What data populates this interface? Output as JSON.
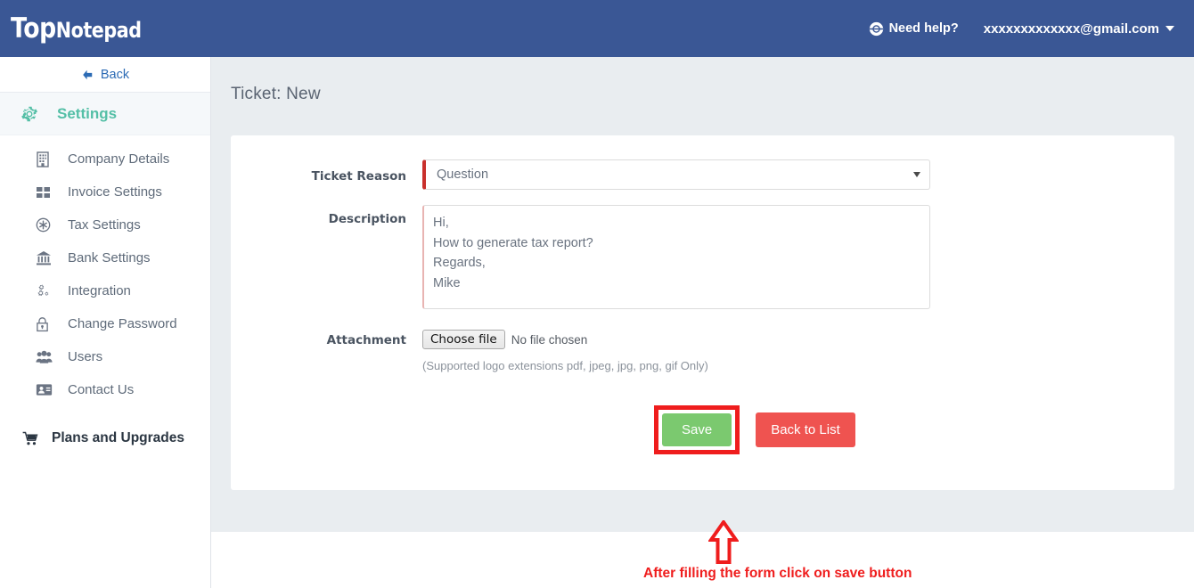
{
  "header": {
    "logo_top": "Top",
    "logo_note": "Notepad",
    "need_help": "Need help?",
    "help_icon": "help-circle-icon",
    "user_email": "xxxxxxxxxxxxx@gmail.com",
    "caret_icon": "chevron-down-icon",
    "background_color": "#3a5795"
  },
  "sidebar": {
    "back_label": "Back",
    "back_icon": "arrow-left-icon",
    "settings_label": "Settings",
    "settings_icon": "gear-icon",
    "settings_color": "#54bfa6",
    "items": [
      {
        "label": "Company Details",
        "icon": "building-icon"
      },
      {
        "label": "Invoice Settings",
        "icon": "grid-squares-icon"
      },
      {
        "label": "Tax Settings",
        "icon": "asterisk-badge-icon"
      },
      {
        "label": "Bank Settings",
        "icon": "bank-icon"
      },
      {
        "label": "Integration",
        "icon": "cogs-icon"
      },
      {
        "label": "Change Password",
        "icon": "lock-icon"
      },
      {
        "label": "Users",
        "icon": "users-icon"
      },
      {
        "label": "Contact Us",
        "icon": "contact-card-icon"
      }
    ],
    "plans_label": "Plans and Upgrades",
    "plans_icon": "shopping-cart-icon"
  },
  "main": {
    "page_title": "Ticket: New",
    "form": {
      "reason_label": "Ticket Reason",
      "reason_value": "Question",
      "reason_caret_icon": "caret-down-icon",
      "description_label": "Description",
      "description_value": "Hi,\nHow to generate tax report?\nRegards,\nMike",
      "attachment_label": "Attachment",
      "choose_file_label": "Choose file",
      "no_file_label": "No file chosen",
      "supported_note": "(Supported logo extensions pdf, jpeg, jpg, png, gif Only)"
    },
    "buttons": {
      "save_label": "Save",
      "save_color": "#7bc96f",
      "back_to_list_label": "Back to List",
      "back_to_list_color": "#ef5350"
    }
  },
  "annotation": {
    "text": "After filling the form click on save button",
    "color": "#ef1d1d",
    "arrow_icon": "arrow-up-outline-icon"
  }
}
